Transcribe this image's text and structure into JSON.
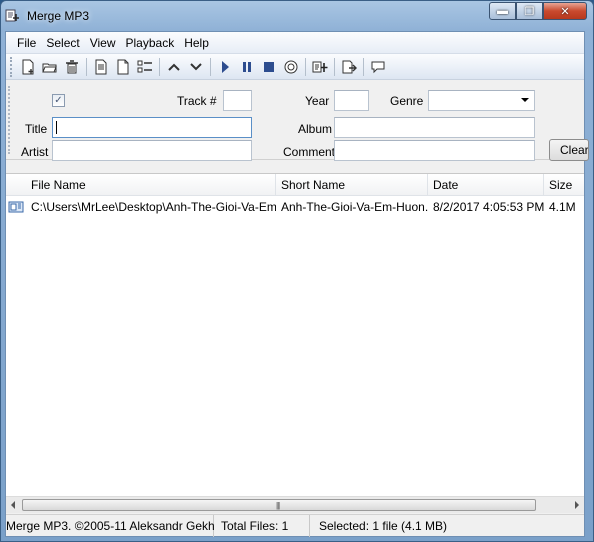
{
  "window": {
    "title": "Merge MP3"
  },
  "titlebar_buttons": {
    "minimize": "▬",
    "maximize": "❐",
    "close": "✕"
  },
  "menu": [
    "File",
    "Select",
    "View",
    "Playback",
    "Help"
  ],
  "toolbar": {
    "groups": [
      [
        "add-files-icon",
        "open-folder-icon",
        "delete-icon"
      ],
      [
        "document-icon",
        "blank-document-icon",
        "checklist-icon"
      ],
      [
        "move-up-icon",
        "move-down-icon"
      ],
      [
        "play-icon",
        "pause-icon",
        "stop-icon",
        "info-icon"
      ],
      [
        "merge-icon"
      ],
      [
        "export-icon"
      ],
      [
        "speech-bubble-icon"
      ]
    ]
  },
  "tags": {
    "checkbox_checked": true,
    "track_label": "Track #",
    "track_value": "",
    "year_label": "Year",
    "year_value": "",
    "genre_label": "Genre",
    "genre_value": "",
    "title_label": "Title",
    "title_value": "",
    "album_label": "Album",
    "album_value": "",
    "artist_label": "Artist",
    "artist_value": "",
    "comment_label": "Comment",
    "comment_value": "",
    "clear_button": "Clear"
  },
  "list": {
    "columns": [
      "File Name",
      "Short Name",
      "Date",
      "Size"
    ],
    "rows": [
      {
        "file_name": "C:\\Users\\MrLee\\Desktop\\Anh-The-Gioi-Va-Em-...",
        "short_name": "Anh-The-Gioi-Va-Em-Huon...",
        "date": "8/2/2017 4:05:53 PM",
        "size": "4.1M"
      }
    ]
  },
  "scrollbar": {
    "grip": "|||"
  },
  "status": {
    "copyright": "Merge MP3. ©2005-11 Aleksandr Gekh",
    "total_files": "Total Files: 1",
    "selected": "Selected: 1 file (4.1 MB)"
  }
}
